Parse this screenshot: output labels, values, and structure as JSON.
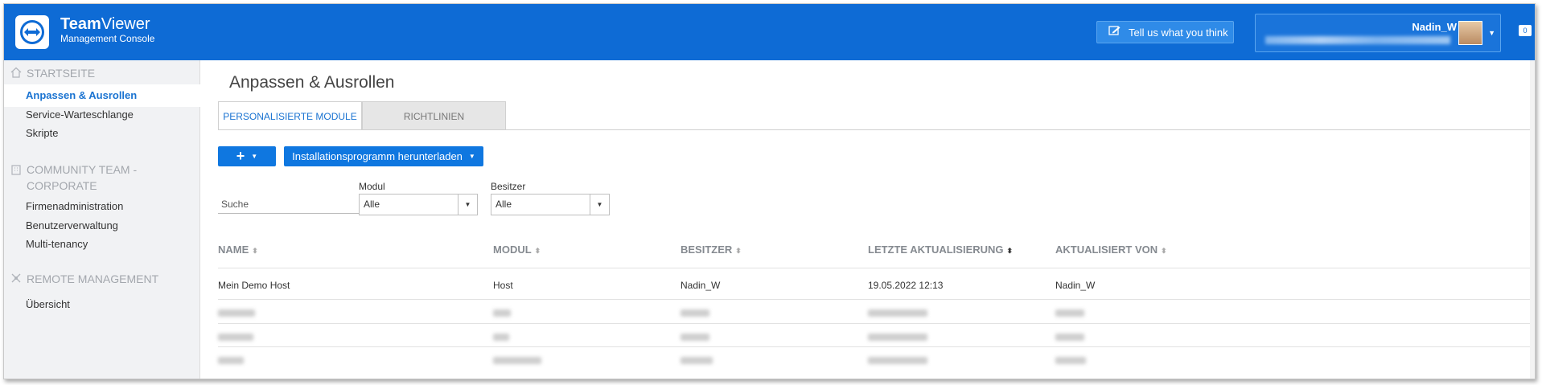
{
  "header": {
    "brand_bold": "Team",
    "brand_light": "Viewer",
    "brand_sub": "Management Console",
    "feedback_label": "Tell us what you think",
    "user_name": "Nadin_W",
    "chat_count": "0"
  },
  "sidebar": {
    "section_home": "STARTSEITE",
    "home_items": [
      {
        "label": "Anpassen & Ausrollen",
        "active": true
      },
      {
        "label": "Service-Warteschlange"
      },
      {
        "label": "Skripte"
      }
    ],
    "section_company": "COMMUNITY TEAM - CORPORATE",
    "company_items": [
      {
        "label": "Firmenadministration"
      },
      {
        "label": "Benutzerverwaltung"
      },
      {
        "label": "Multi-tenancy"
      }
    ],
    "section_remote": "REMOTE MANAGEMENT",
    "remote_items": [
      {
        "label": "Übersicht"
      }
    ]
  },
  "main": {
    "title": "Anpassen & Ausrollen",
    "tabs": [
      {
        "label": "PERSONALISIERTE MODULE",
        "active": true
      },
      {
        "label": "RICHTLINIEN",
        "active": false
      }
    ],
    "add_button": "+",
    "install_button": "Installationsprogramm herunterladen",
    "search_placeholder": "Suche",
    "filter_module_label": "Modul",
    "filter_module_value": "Alle",
    "filter_owner_label": "Besitzer",
    "filter_owner_value": "Alle",
    "columns": [
      "NAME",
      "MODUL",
      "BESITZER",
      "LETZTE AKTUALISIERUNG",
      "AKTUALISIERT VON"
    ],
    "rows": [
      [
        "Mein Demo Host",
        "Host",
        "Nadin_W",
        "19.05.2022 12:13",
        "Nadin_W"
      ]
    ]
  },
  "colors": {
    "header_bg": "#0e6bd5",
    "accent": "#1a73d1",
    "button_bg": "#0f77e0",
    "sidebar_bg": "#f1f2f4"
  }
}
